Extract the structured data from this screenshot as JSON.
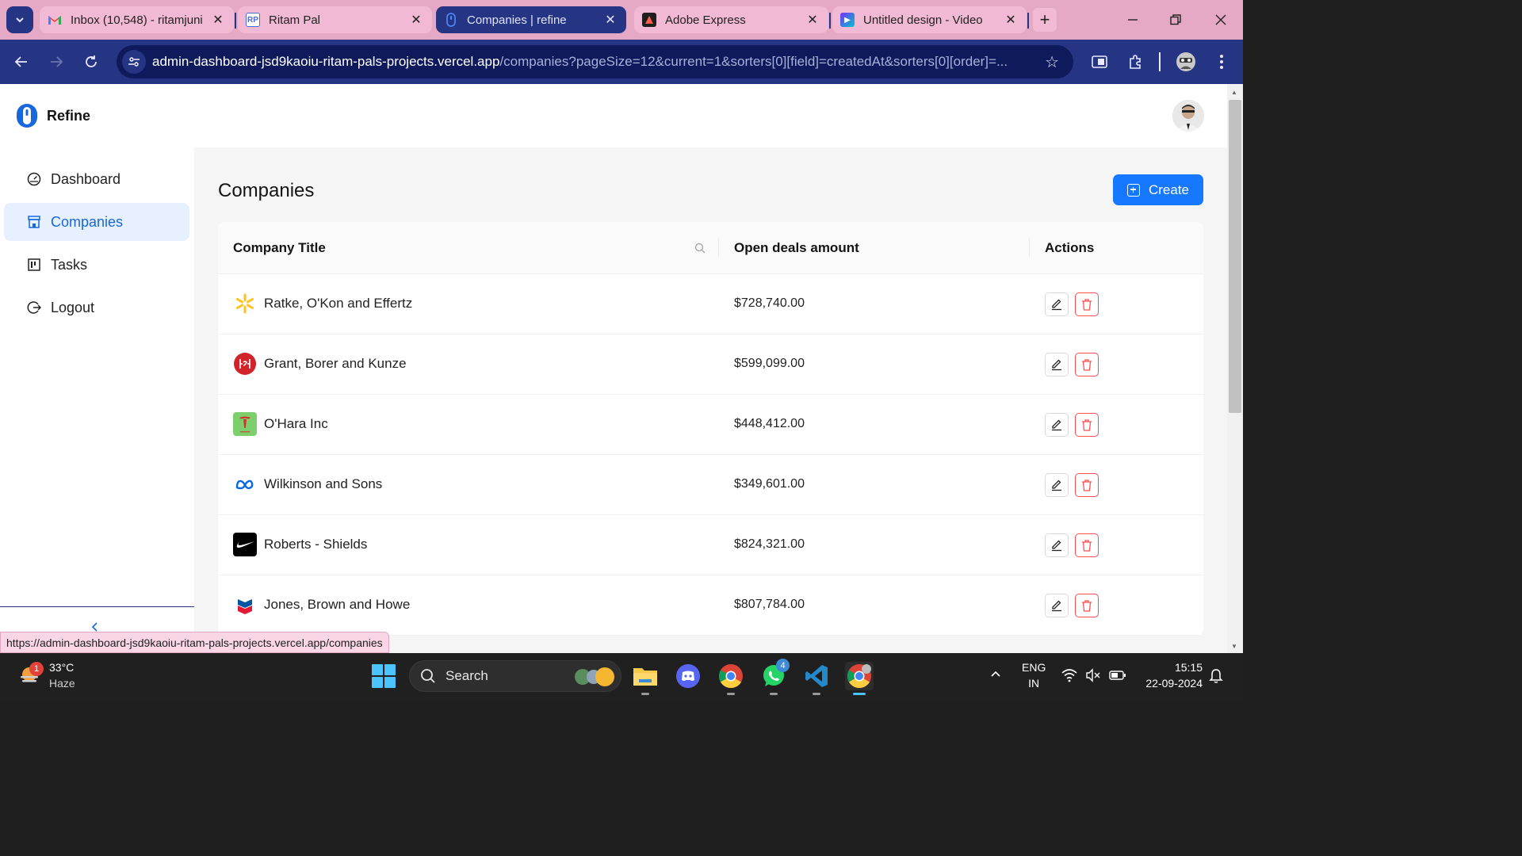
{
  "browser": {
    "tabs": [
      {
        "title": "Inbox (10,548) - ritamjuni",
        "favicon": "gmail-icon",
        "active": false
      },
      {
        "title": "Ritam Pal",
        "favicon": "profile-site-icon",
        "active": false
      },
      {
        "title": "Companies | refine",
        "favicon": "refine-icon",
        "active": true
      },
      {
        "title": "Adobe Express",
        "favicon": "adobe-express-icon",
        "active": false
      },
      {
        "title": "Untitled design - Video",
        "favicon": "canva-video-icon",
        "active": false
      }
    ],
    "url_host": "admin-dashboard-jsd9kaoiu-ritam-pals-projects.vercel.app",
    "url_path": "/companies?pageSize=12&current=1&sorters[0][field]=createdAt&sorters[0][order]=...",
    "status_url": "https://admin-dashboard-jsd9kaoiu-ritam-pals-projects.vercel.app/companies"
  },
  "app": {
    "brand": "Refine",
    "accent_color": "#1677ff",
    "menu": [
      {
        "label": "Dashboard",
        "icon": "dashboard-gauge-icon",
        "selected": false
      },
      {
        "label": "Companies",
        "icon": "shop-icon",
        "selected": true
      },
      {
        "label": "Tasks",
        "icon": "kanban-board-icon",
        "selected": false
      },
      {
        "label": "Logout",
        "icon": "logout-icon",
        "selected": false
      }
    ]
  },
  "page": {
    "title": "Companies",
    "create_label": "Create",
    "columns": {
      "title": "Company Title",
      "amount": "Open deals amount",
      "actions": "Actions"
    },
    "rows": [
      {
        "name": "Ratke, O'Kon and Effertz",
        "amount": "$728,740.00",
        "logo": "walmart-spark-logo"
      },
      {
        "name": "Grant, Borer and Kunze",
        "amount": "$599,099.00",
        "logo": "red-circle-logo"
      },
      {
        "name": "O'Hara Inc",
        "amount": "$448,412.00",
        "logo": "tesla-logo"
      },
      {
        "name": "Wilkinson and Sons",
        "amount": "$349,601.00",
        "logo": "meta-infinity-logo"
      },
      {
        "name": "Roberts - Shields",
        "amount": "$824,321.00",
        "logo": "nike-swoosh-logo"
      },
      {
        "name": "Jones, Brown and Howe",
        "amount": "$807,784.00",
        "logo": "chevron-logo"
      }
    ]
  },
  "taskbar": {
    "weather_temp": "33°C",
    "weather_desc": "Haze",
    "weather_badge": "1",
    "search_label": "Search",
    "whatsapp_badge": "4",
    "lang_top": "ENG",
    "lang_bottom": "IN",
    "time": "15:15",
    "date": "22-09-2024"
  }
}
